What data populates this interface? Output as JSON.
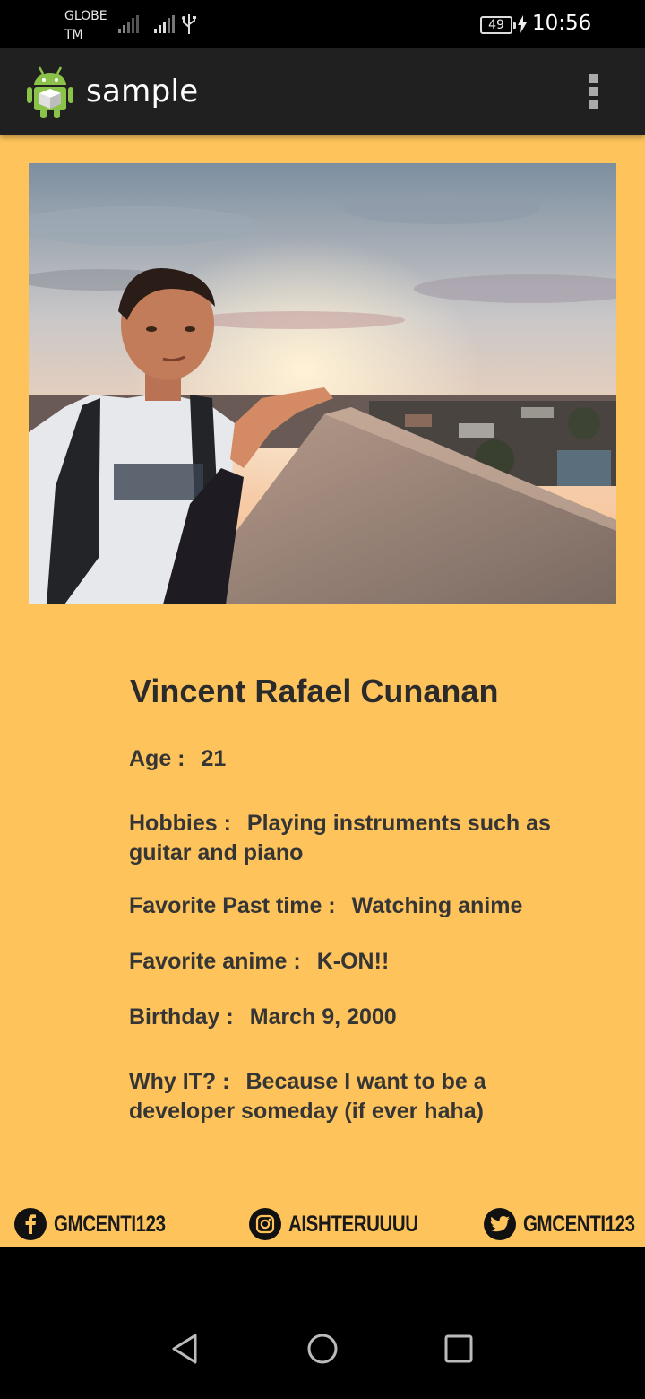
{
  "status_bar": {
    "carrier_line1": "GLOBE",
    "carrier_line2": "TM",
    "battery_level": "49",
    "time": "10:56"
  },
  "app_bar": {
    "title": "sample"
  },
  "profile": {
    "name": "Vincent Rafael Cunanan",
    "fields": [
      {
        "label": "Age :",
        "value": "21"
      },
      {
        "label": "Hobbies :",
        "value": "Playing instruments such as guitar and piano"
      },
      {
        "label": "Favorite Past time :",
        "value": "Watching anime"
      },
      {
        "label": "Favorite anime :",
        "value": "K-ON!!"
      },
      {
        "label": "Birthday :",
        "value": "March 9, 2000"
      },
      {
        "label": "Why IT? :",
        "value": "Because I want to be a developer someday (if ever haha)"
      }
    ]
  },
  "socials": {
    "facebook": "GMCENTI123",
    "instagram": "AISHTERUUUU",
    "twitter": "GMCENTI123"
  },
  "colors": {
    "background": "#fec45b",
    "app_bar": "#202020",
    "text": "#353535"
  }
}
